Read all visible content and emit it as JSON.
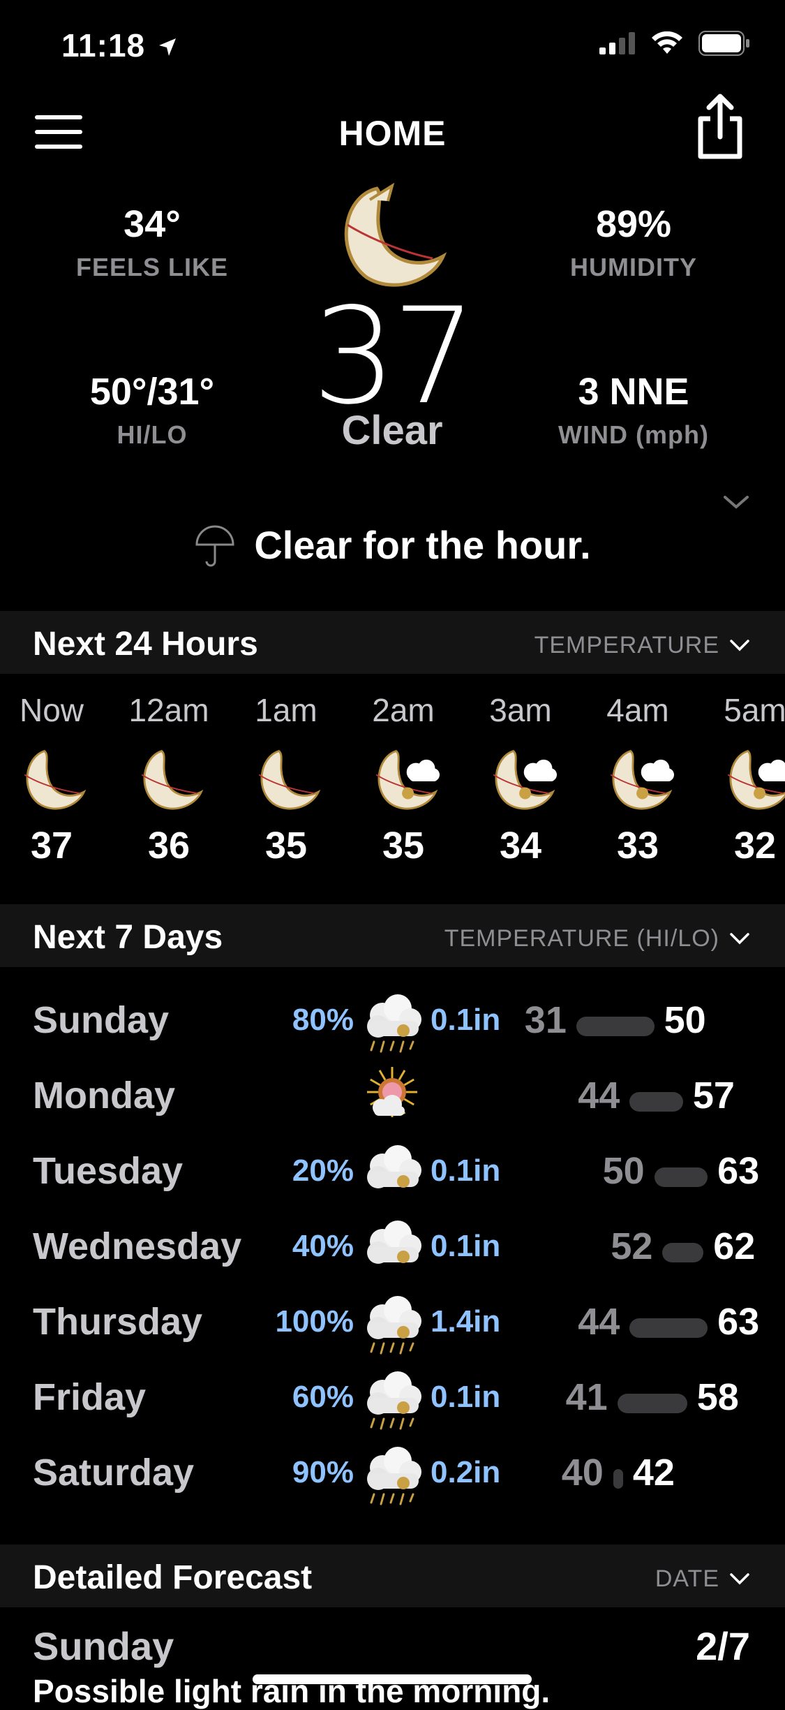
{
  "status_bar": {
    "time": "11:18"
  },
  "header": {
    "title": "HOME"
  },
  "current": {
    "feels_like": {
      "value": "34°",
      "label": "FEELS LIKE"
    },
    "humidity": {
      "value": "89%",
      "label": "HUMIDITY"
    },
    "hilo": {
      "value": "50°/31°",
      "label": "HI/LO"
    },
    "wind": {
      "value": "3 NNE",
      "label": "WIND (mph)"
    },
    "temperature": "37",
    "condition": "Clear",
    "nowcast": "Clear for the hour."
  },
  "hourly": {
    "title": "Next 24 Hours",
    "selector": "TEMPERATURE",
    "hours": [
      {
        "time": "Now",
        "temp": "37",
        "icon": "moon-icon"
      },
      {
        "time": "12am",
        "temp": "36",
        "icon": "moon-icon"
      },
      {
        "time": "1am",
        "temp": "35",
        "icon": "moon-icon"
      },
      {
        "time": "2am",
        "temp": "35",
        "icon": "moon-cloud-icon"
      },
      {
        "time": "3am",
        "temp": "34",
        "icon": "moon-cloud-icon"
      },
      {
        "time": "4am",
        "temp": "33",
        "icon": "moon-cloud-icon"
      },
      {
        "time": "5am",
        "temp": "32",
        "icon": "moon-cloud-icon"
      }
    ]
  },
  "daily": {
    "title": "Next 7 Days",
    "selector": "TEMPERATURE (HI/LO)",
    "days": [
      {
        "name": "Sunday",
        "pop": "80%",
        "amount": "0.1in",
        "lo": "31",
        "hi": "50",
        "icon": "rain-cloud-icon"
      },
      {
        "name": "Monday",
        "pop": "",
        "amount": "",
        "lo": "44",
        "hi": "57",
        "icon": "sun-cloud-icon"
      },
      {
        "name": "Tuesday",
        "pop": "20%",
        "amount": "0.1in",
        "lo": "50",
        "hi": "63",
        "icon": "cloud-icon"
      },
      {
        "name": "Wednesday",
        "pop": "40%",
        "amount": "0.1in",
        "lo": "52",
        "hi": "62",
        "icon": "cloud-icon"
      },
      {
        "name": "Thursday",
        "pop": "100%",
        "amount": "1.4in",
        "lo": "44",
        "hi": "63",
        "icon": "rain-cloud-icon"
      },
      {
        "name": "Friday",
        "pop": "60%",
        "amount": "0.1in",
        "lo": "41",
        "hi": "58",
        "icon": "rain-cloud-icon"
      },
      {
        "name": "Saturday",
        "pop": "90%",
        "amount": "0.2in",
        "lo": "40",
        "hi": "42",
        "icon": "rain-cloud-icon"
      }
    ]
  },
  "detailed": {
    "title": "Detailed Forecast",
    "selector": "DATE",
    "day": "Sunday",
    "date": "2/7",
    "text": "Possible light rain in the morning."
  }
}
